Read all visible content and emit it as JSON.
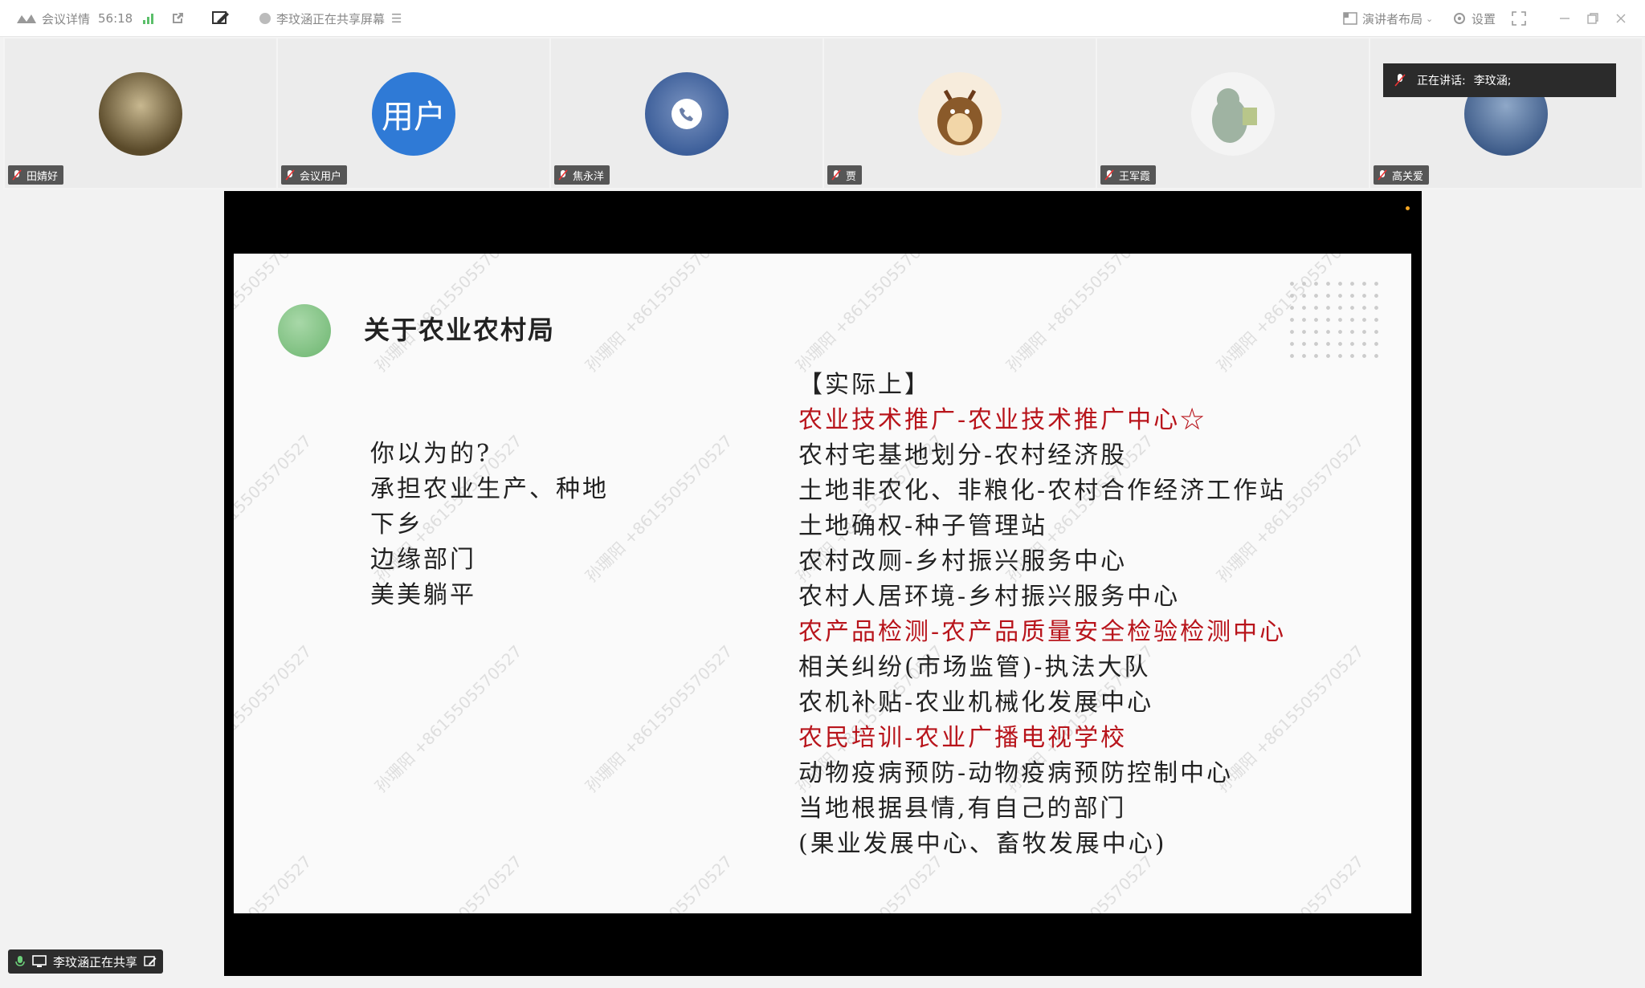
{
  "titlebar": {
    "meeting_details": "会议详情",
    "timer": "56:18",
    "sharing_status": "李玟涵正在共享屏幕",
    "layout_label": "演讲者布局",
    "settings_label": "设置"
  },
  "participants": [
    {
      "name": "田婧好",
      "avatar_color": "#5a4a2a"
    },
    {
      "name": "会议用户",
      "avatar_text": "用户",
      "avatar_color": "#2f7ad6"
    },
    {
      "name": "焦永洋",
      "avatar_color": "#4a6aa0"
    },
    {
      "name": "贾",
      "avatar_color": "#f0d8b8"
    },
    {
      "name": "王军霞",
      "avatar_color": "#f0f0f0"
    },
    {
      "name": "高关爱",
      "avatar_color": "#4a6a9a"
    }
  ],
  "speaking": {
    "label": "正在讲话:",
    "speaker": "李玟涵;"
  },
  "share_badge": {
    "label": "李玟涵正在共享"
  },
  "watermark": "孙珊阳 +8615505570527",
  "slide": {
    "title": "关于农业农村局",
    "left_lines": [
      "你以为的?",
      "承担农业生产、种地",
      "下乡",
      "边缘部门",
      "美美躺平"
    ],
    "right_lines": [
      {
        "text": "【实际上】",
        "red": false
      },
      {
        "text": "农业技术推广-农业技术推广中心☆",
        "red": true
      },
      {
        "text": "农村宅基地划分-农村经济股",
        "red": false
      },
      {
        "text": "土地非农化、非粮化-农村合作经济工作站",
        "red": false
      },
      {
        "text": "土地确权-种子管理站",
        "red": false
      },
      {
        "text": "农村改厕-乡村振兴服务中心",
        "red": false
      },
      {
        "text": "农村人居环境-乡村振兴服务中心",
        "red": false
      },
      {
        "text": "农产品检测-农产品质量安全检验检测中心",
        "red": true
      },
      {
        "text": "相关纠纷(市场监管)-执法大队",
        "red": false
      },
      {
        "text": "农机补贴-农业机械化发展中心",
        "red": false
      },
      {
        "text": "农民培训-农业广播电视学校",
        "red": true
      },
      {
        "text": "动物疫病预防-动物疫病预防控制中心",
        "red": false
      },
      {
        "text": "当地根据县情,有自己的部门",
        "red": false
      },
      {
        "text": "(果业发展中心、畜牧发展中心)",
        "red": false
      }
    ]
  }
}
